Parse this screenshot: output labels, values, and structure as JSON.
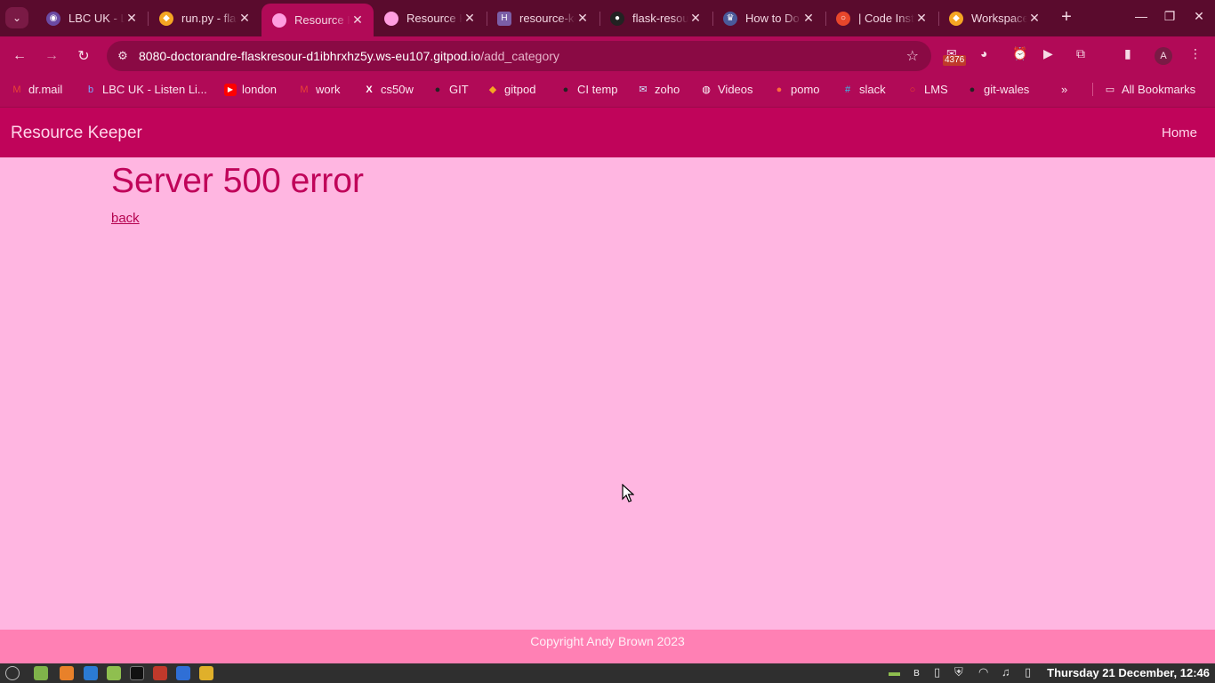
{
  "browser": {
    "tabs": [
      {
        "title": "LBC UK - Listen Live",
        "favicon": "lbc-icon",
        "color": "#6b4aa3",
        "active": false
      },
      {
        "title": "run.py - flask",
        "favicon": "gitpod-icon",
        "color": "#f5a623",
        "active": false
      },
      {
        "title": "Resource Keeper",
        "favicon": "pink-circle-icon",
        "color": "#ff9ee0",
        "active": true
      },
      {
        "title": "Resource Keeper",
        "favicon": "pink-circle-icon",
        "color": "#ff9ee0",
        "active": false
      },
      {
        "title": "resource-keeper",
        "favicon": "heroku-icon",
        "color": "#7b5ea7",
        "active": false
      },
      {
        "title": "flask-resource",
        "favicon": "github-icon",
        "color": "#222222",
        "active": false
      },
      {
        "title": "How to Do",
        "favicon": "howto-icon",
        "color": "#4a5a9a",
        "active": false
      },
      {
        "title": "| Code Institute",
        "favicon": "code-institute-icon",
        "color": "#e8462b",
        "active": false
      },
      {
        "title": "Workspaces",
        "favicon": "gitpod-icon",
        "color": "#f5a623",
        "active": false
      }
    ],
    "url_host": "8080-doctorandre-flaskresour-d1ibhrxhz5y.ws-eu107.gitpod.io",
    "url_path": "/add_category",
    "extension_badge": "4376",
    "profile_initial": "A",
    "bookmarks": [
      {
        "label": "dr.mail",
        "icon": "gmail-icon"
      },
      {
        "label": "LBC UK - Listen Li...",
        "icon": "lbc-icon"
      },
      {
        "label": "london",
        "icon": "youtube-icon"
      },
      {
        "label": "work",
        "icon": "gmail-icon"
      },
      {
        "label": "cs50w",
        "icon": "x-icon"
      },
      {
        "label": "GIT",
        "icon": "github-icon"
      },
      {
        "label": "gitpod",
        "icon": "gitpod-icon"
      },
      {
        "label": "CI temp",
        "icon": "github-icon"
      },
      {
        "label": "zoho",
        "icon": "zoho-icon"
      },
      {
        "label": "Videos",
        "icon": "globe-icon"
      },
      {
        "label": "pomo",
        "icon": "tomato-icon"
      },
      {
        "label": "slack",
        "icon": "slack-icon"
      },
      {
        "label": "LMS",
        "icon": "code-institute-icon"
      },
      {
        "label": "git-wales",
        "icon": "github-icon"
      }
    ],
    "all_bookmarks": "All Bookmarks"
  },
  "page": {
    "brand": "Resource Keeper",
    "nav_home": "Home",
    "error_title": "Server 500 error",
    "back_link": "back",
    "footer": "Copyright Andy Brown 2023"
  },
  "taskbar": {
    "clock": "Thursday 21 December, 12:46"
  }
}
